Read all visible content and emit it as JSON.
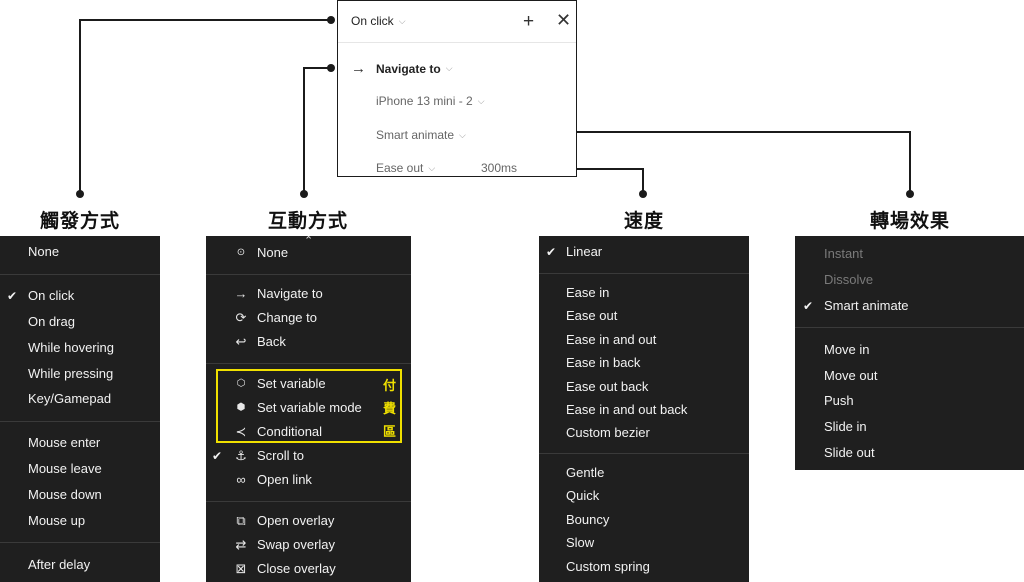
{
  "panel": {
    "trigger": "On click",
    "action": "Navigate to",
    "destination": "iPhone 13 mini - 2",
    "animation": "Smart animate",
    "easing": "Ease out",
    "duration": "300ms",
    "icons": {
      "arrow": "arrow-right-icon",
      "add": "plus-icon",
      "close": "close-icon"
    }
  },
  "headings": {
    "trigger": "觸發方式",
    "interaction": "互動方式",
    "speed": "速度",
    "transition": "轉場效果"
  },
  "trigger_menu": {
    "none": "None",
    "on_click": "On click",
    "on_drag": "On drag",
    "while_hovering": "While hovering",
    "while_pressing": "While pressing",
    "key_gamepad": "Key/Gamepad",
    "mouse_enter": "Mouse enter",
    "mouse_leave": "Mouse leave",
    "mouse_down": "Mouse down",
    "mouse_up": "Mouse up",
    "after_delay": "After delay",
    "check": "✔"
  },
  "action_menu": {
    "none": "None",
    "navigate_to": "Navigate to",
    "change_to": "Change to",
    "back": "Back",
    "set_variable": "Set variable",
    "set_variable_mode": "Set variable mode",
    "conditional": "Conditional",
    "scroll_to": "Scroll to",
    "open_link": "Open link",
    "open_overlay": "Open overlay",
    "swap_overlay": "Swap overlay",
    "close_overlay": "Close overlay",
    "paid_1": "付",
    "paid_2": "費",
    "paid_3": "區",
    "check": "✔",
    "scroll_up": "⌃"
  },
  "speed_menu": {
    "linear": "Linear",
    "ease_in": "Ease in",
    "ease_out": "Ease out",
    "ease_in_out": "Ease in and out",
    "ease_in_back": "Ease in back",
    "ease_out_back": "Ease out back",
    "ease_in_out_back": "Ease in and out back",
    "custom_bezier": "Custom bezier",
    "gentle": "Gentle",
    "quick": "Quick",
    "bouncy": "Bouncy",
    "slow": "Slow",
    "custom_spring": "Custom spring",
    "check": "✔"
  },
  "transition_menu": {
    "instant": "Instant",
    "dissolve": "Dissolve",
    "smart_animate": "Smart animate",
    "move_in": "Move in",
    "move_out": "Move out",
    "push": "Push",
    "slide_in": "Slide in",
    "slide_out": "Slide out",
    "check": "✔"
  },
  "colors": {
    "menu_bg": "#1f1f1f",
    "highlight": "#f0e000",
    "line": "#1b1b1b"
  }
}
